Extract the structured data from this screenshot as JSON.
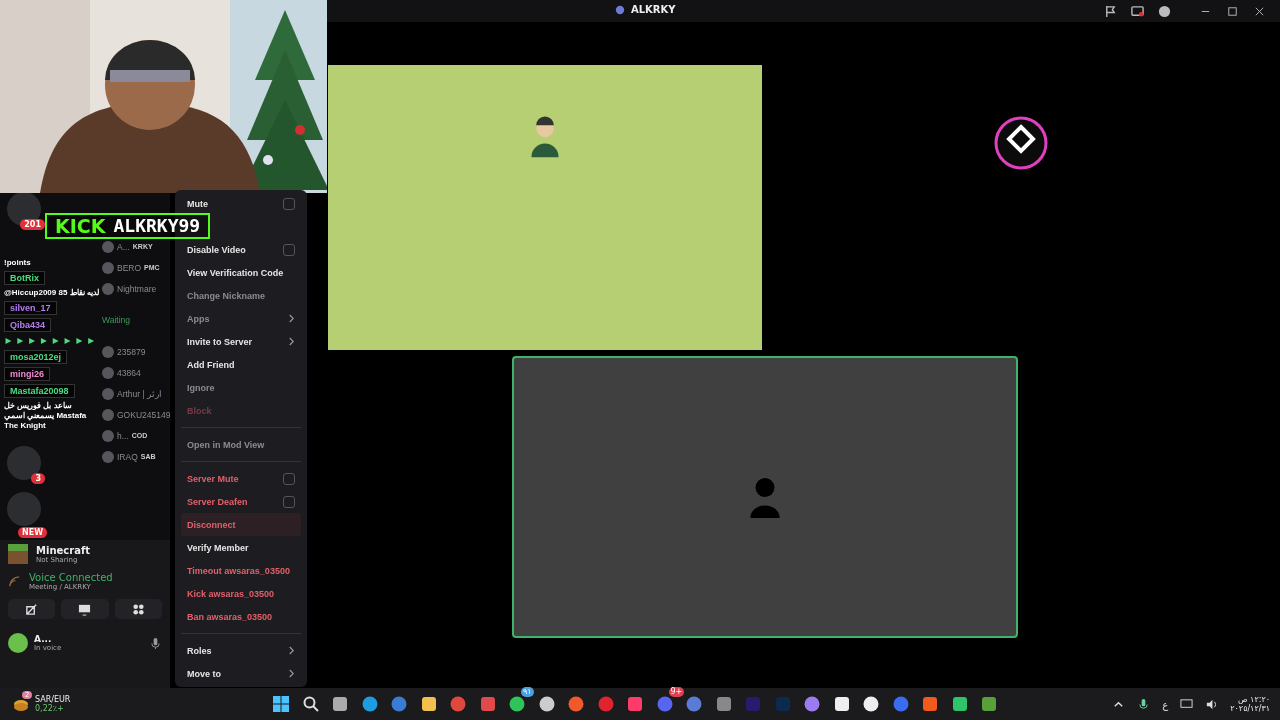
{
  "window": {
    "title": "ALKRKY"
  },
  "stream_overlay": {
    "brand": "KICK",
    "channel": "ALKRKY99"
  },
  "chat": [
    {
      "kind": "plain",
      "text": "!points"
    },
    {
      "kind": "name",
      "text": "BotRix",
      "color": "#4ade80"
    },
    {
      "kind": "plain",
      "text": "@Hiccup2009 85 لديه نقاط"
    },
    {
      "kind": "name",
      "text": "silven_17",
      "color": "#b57bf0"
    },
    {
      "kind": "name",
      "text": "Qiba434",
      "color": "#b57bf0"
    },
    {
      "kind": "emotes"
    },
    {
      "kind": "name",
      "text": "mosa2012ej",
      "color": "#4ade80"
    },
    {
      "kind": "name",
      "text": "mingi26",
      "color": "#f08bd0"
    },
    {
      "kind": "name",
      "text": "Mastafa20098",
      "color": "#4ade80"
    },
    {
      "kind": "plain",
      "text": "ساعد بل فوريس خل يسمعني اسمي Mastafa The Knight"
    }
  ],
  "servers": [
    {
      "badge": "201"
    },
    {
      "badge": "3"
    },
    {
      "badge": "NEW"
    }
  ],
  "members": [
    {
      "kind": "member",
      "name": "A...",
      "tag": "KRKY"
    },
    {
      "kind": "member",
      "name": "BERO",
      "tag": "PMC"
    },
    {
      "kind": "member",
      "name": "Nightmare"
    },
    {
      "kind": "channel",
      "name": "Waiting"
    },
    {
      "kind": "member",
      "name": "235879"
    },
    {
      "kind": "member",
      "name": "43864"
    },
    {
      "kind": "member",
      "name": "Arthur | ارثر"
    },
    {
      "kind": "member",
      "name": "GOKU245149"
    },
    {
      "kind": "member",
      "name": "h...",
      "tag": "COD"
    },
    {
      "kind": "member",
      "name": "IRAQ",
      "tag": "SAB"
    }
  ],
  "activity": {
    "game": "Minecraft",
    "status": "Not Sharing"
  },
  "voice": {
    "status": "Voice Connected",
    "channel": "Meeting / ALKRKY"
  },
  "user": {
    "name": "A...",
    "status": "In voice"
  },
  "menu": [
    {
      "kind": "checkbox",
      "label": "Mute",
      "danger": false,
      "disabled": false,
      "checked": false,
      "hovered": false
    },
    {
      "kind": "checkbox",
      "label": "Disable Video",
      "danger": false,
      "disabled": false,
      "checked": false,
      "hovered": false
    },
    {
      "kind": "item",
      "label": "View Verification Code",
      "danger": false,
      "disabled": false,
      "hovered": false
    },
    {
      "kind": "item",
      "label": "Change Nickname",
      "danger": false,
      "disabled": true,
      "hovered": false
    },
    {
      "kind": "submenu",
      "label": "Apps",
      "danger": false,
      "disabled": true,
      "hovered": false
    },
    {
      "kind": "submenu",
      "label": "Invite to Server",
      "danger": false,
      "disabled": false,
      "hovered": false
    },
    {
      "kind": "item",
      "label": "Add Friend",
      "danger": false,
      "disabled": false,
      "hovered": false
    },
    {
      "kind": "item",
      "label": "Ignore",
      "danger": false,
      "disabled": true,
      "hovered": false
    },
    {
      "kind": "item",
      "label": "Block",
      "danger": true,
      "disabled": true,
      "hovered": false
    },
    {
      "kind": "separator"
    },
    {
      "kind": "item",
      "label": "Open in Mod View",
      "danger": false,
      "disabled": true,
      "hovered": false
    },
    {
      "kind": "separator"
    },
    {
      "kind": "checkbox",
      "label": "Server Mute",
      "danger": true,
      "disabled": false,
      "checked": false,
      "hovered": false
    },
    {
      "kind": "checkbox",
      "label": "Server Deafen",
      "danger": true,
      "disabled": false,
      "checked": false,
      "hovered": false
    },
    {
      "kind": "item",
      "label": "Disconnect",
      "danger": true,
      "disabled": false,
      "hovered": true
    },
    {
      "kind": "item",
      "label": "Verify Member",
      "danger": false,
      "disabled": false,
      "hovered": false
    },
    {
      "kind": "item",
      "label": "Timeout awsaras_03500",
      "danger": true,
      "disabled": false,
      "hovered": false
    },
    {
      "kind": "item",
      "label": "Kick awsaras_03500",
      "danger": true,
      "disabled": false,
      "hovered": false
    },
    {
      "kind": "item",
      "label": "Ban awsaras_03500",
      "danger": true,
      "disabled": false,
      "hovered": false
    },
    {
      "kind": "separator"
    },
    {
      "kind": "submenu",
      "label": "Roles",
      "danger": false,
      "disabled": false,
      "hovered": false
    },
    {
      "kind": "submenu",
      "label": "Move to",
      "danger": false,
      "disabled": false,
      "hovered": false
    }
  ],
  "taskbar": {
    "widget": {
      "title": "SAR/EUR",
      "value": "0,22٪+",
      "badge": "2"
    },
    "whatsapp_badge": "٩١",
    "discord_badge": "9+",
    "language": "ع",
    "time": "١٢:٢٠ ص",
    "date": "٢٠٢٥/١٢/٣١"
  }
}
